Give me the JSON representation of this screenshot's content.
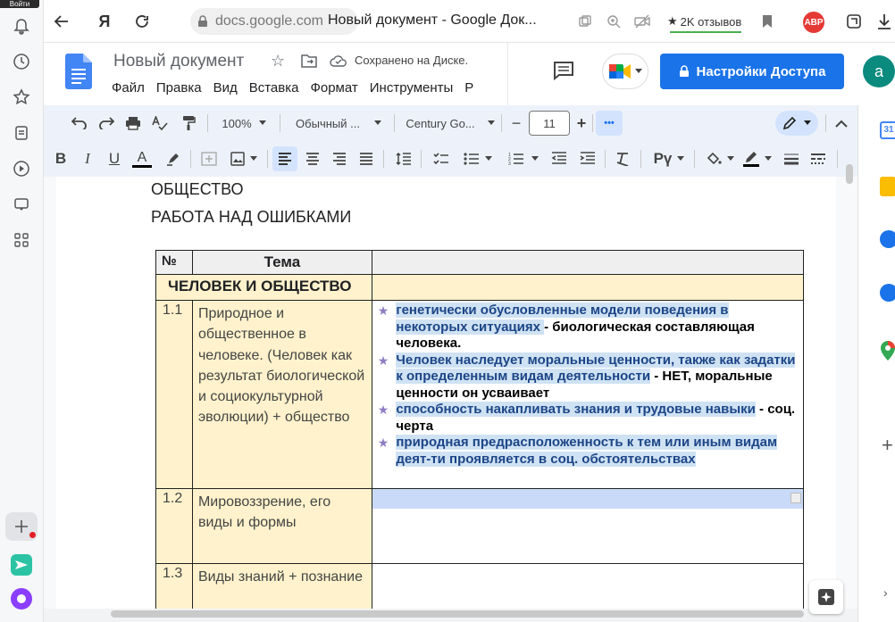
{
  "browser": {
    "login_badge": "Войти",
    "url": "docs.google.com",
    "tab_title": "Новый документ - Google Док...",
    "reviews": "2K отзывов",
    "adblock": "ABP"
  },
  "docs": {
    "title": "Новый документ",
    "save_status": "Сохранено на Диске.",
    "menu": [
      "Файл",
      "Правка",
      "Вид",
      "Вставка",
      "Формат",
      "Инструменты",
      "Р"
    ],
    "access_button": "Настройки Доступа",
    "avatar_letter": "a"
  },
  "toolbar": {
    "zoom": "100%",
    "style": "Обычный ...",
    "font": "Century Go...",
    "font_size": "11",
    "minus": "−",
    "plus": "+",
    "more": "•••"
  },
  "document": {
    "line1": "ОБЩЕСТВО",
    "line2": "РАБОТА НАД ОШИБКАМИ",
    "header_num": "№",
    "header_topic": "Тема",
    "section": "ЧЕЛОВЕК И ОБЩЕСТВО",
    "rows": [
      {
        "num": "1.1",
        "topic": "Природное и общественное в человеке. (Человек как результат биологической и социокультурной эволюции) + общество",
        "bullets": [
          {
            "hl": "генетически обусловленные модели поведения в некоторых ситуациях ",
            "plain": " - биологическая составляющая человека."
          },
          {
            "hl": "Человек наследует моральные ценности, также как задатки к определенным видам деятельности",
            "plain": " - НЕТ, моральные ценности он усваивает"
          },
          {
            "hl": "способность накапливать знания и трудовые навыки",
            "plain": " - соц. черта"
          },
          {
            "hl": "природная предрасположенность к тем или иным видам деят-ти проявляется в соц. обстоятельствах",
            "plain": ""
          }
        ]
      },
      {
        "num": "1.2",
        "topic": "Мировоззрение, его виды и формы"
      },
      {
        "num": "1.3",
        "topic": "Виды знаний + познание"
      }
    ]
  },
  "colors": {
    "accent": "#1a73e8",
    "table_bg": "#fff2cc",
    "highlight": "#cfe2f3",
    "highlight_text": "#1c4587",
    "star": "#8e7cc3"
  }
}
